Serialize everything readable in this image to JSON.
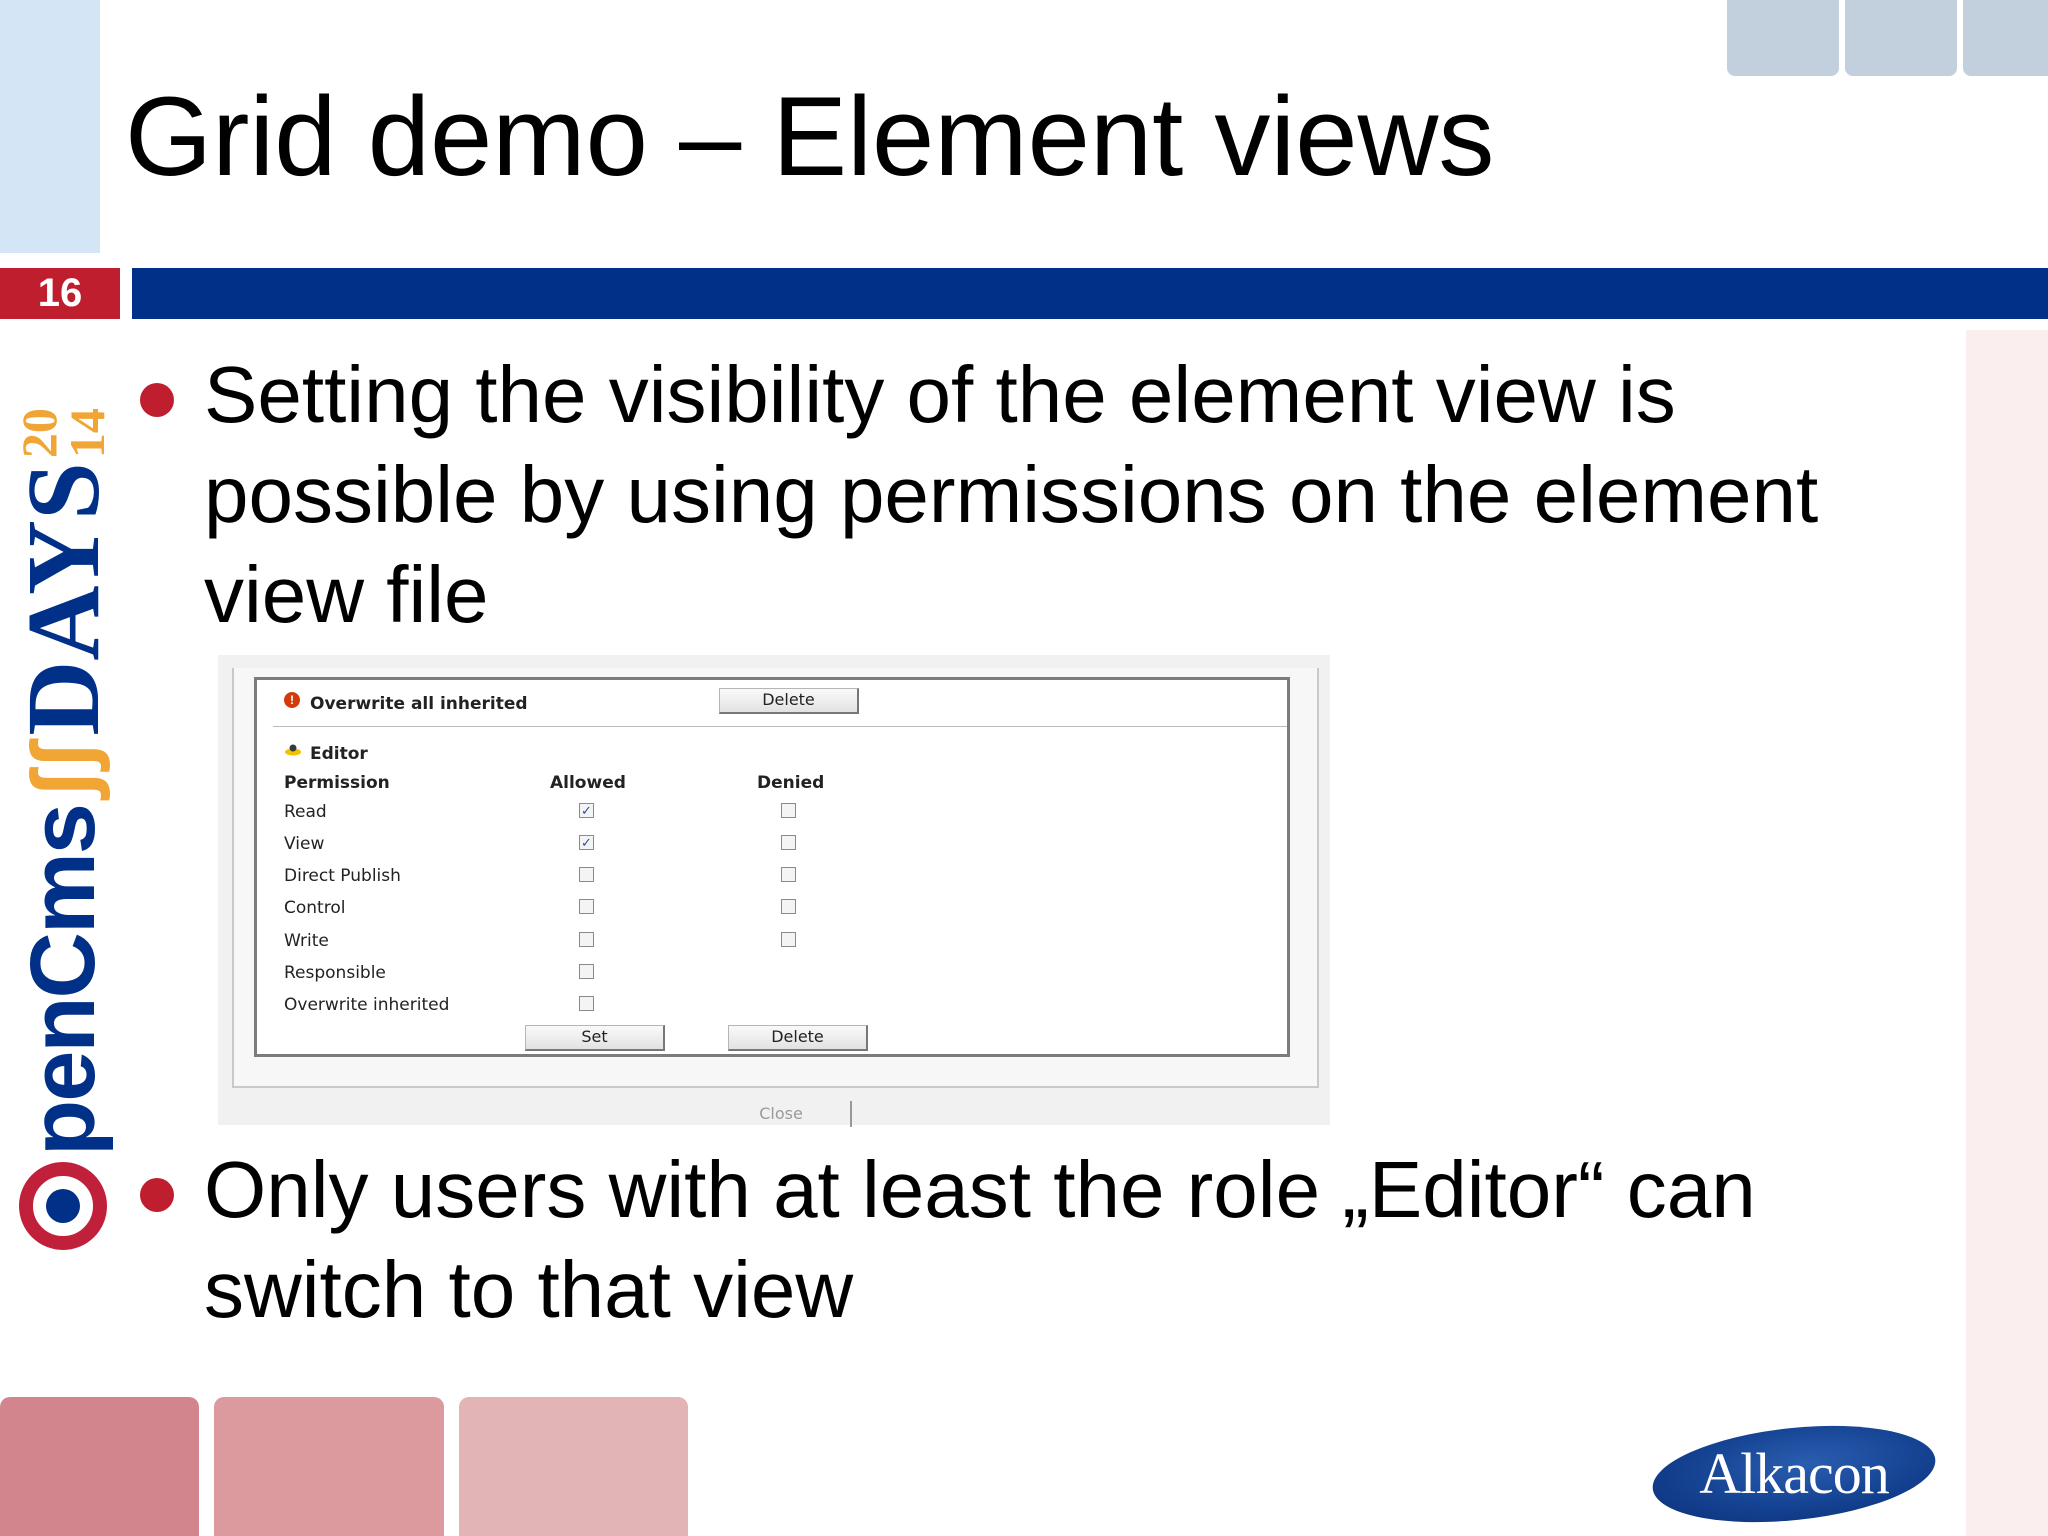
{
  "slide": {
    "title": "Grid demo – Element views",
    "number": "16",
    "bullets": [
      "Setting the visibility of the element view is possible by using permissions on the element view file",
      "Only users with at least the role „Editor“ can switch to that view"
    ]
  },
  "logo": {
    "opencms": "penCms",
    "days": "DAYS",
    "year_top": "20",
    "year_bottom": "14"
  },
  "dialog": {
    "overwrite_label": "Overwrite all inherited",
    "top_delete_label": "Delete",
    "principal_label": "Editor",
    "columns": {
      "permission": "Permission",
      "allowed": "Allowed",
      "denied": "Denied"
    },
    "permissions": [
      {
        "label": "Read",
        "allowed": true,
        "denied": false
      },
      {
        "label": "View",
        "allowed": true,
        "denied": false
      },
      {
        "label": "Direct Publish",
        "allowed": false,
        "denied": false
      },
      {
        "label": "Control",
        "allowed": false,
        "denied": false
      },
      {
        "label": "Write",
        "allowed": false,
        "denied": false
      },
      {
        "label": "Responsible",
        "allowed": false
      },
      {
        "label": "Overwrite inherited",
        "allowed": false
      }
    ],
    "set_label": "Set",
    "delete_label": "Delete",
    "close_label": "Close"
  },
  "brand": {
    "company": "Alkacon"
  },
  "colors": {
    "accent_red": "#bf1e2e",
    "brand_blue": "#003087",
    "flame_orange": "#f0a535"
  }
}
